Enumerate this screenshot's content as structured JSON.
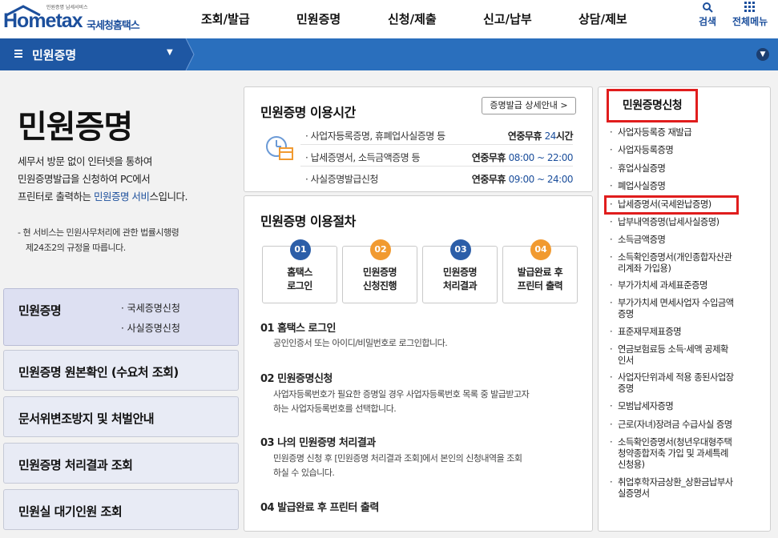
{
  "header": {
    "logo_small": "민원증명 납세서비스",
    "logo_main": "Hometax",
    "logo_kr": "국세청홈택스",
    "nav": [
      "조회/발급",
      "민원증명",
      "신청/제출",
      "신고/납부",
      "상담/제보"
    ],
    "search_label": "검색",
    "allmenu_label": "전체메뉴"
  },
  "bar": {
    "title": "민원증명"
  },
  "left": {
    "page_title": "민원증명",
    "desc_line1": "세무서 방문 없이 인터넷을 통하여",
    "desc_line2": "민원증명발급을 신청하여 PC에서",
    "desc_line3_pre": "프린터로 출력하는 ",
    "desc_line3_link": "민원증명 서비",
    "desc_line3_post": "스입니다.",
    "note_line1": "- 현 서비스는 민원사무처리에 관한 법률시행령",
    "note_line2": "제24조2의 규정을 따릅니다.",
    "boxes": [
      {
        "title": "민원증명",
        "subs": [
          "· 국세증명신청",
          "· 사실증명신청"
        ]
      },
      {
        "title": "민원증명 원본확인 (수요처 조회)"
      },
      {
        "title": "문서위변조방지 및 처벌안내"
      },
      {
        "title": "민원증명 처리결과 조회"
      },
      {
        "title": "민원실 대기인원 조회"
      }
    ]
  },
  "hours": {
    "title": "민원증명 이용시간",
    "detail_button": "증명발급 상세안내 >",
    "rows": [
      {
        "label": "· 사업자등록증명, 휴폐업사실증명 등",
        "prefix": "연중무휴 ",
        "time": "24",
        "suffix": "시간"
      },
      {
        "label": "· 납세증명서, 소득금액증명 등",
        "prefix": "연중무휴 ",
        "time": "08:00 ~ 22:00",
        "suffix": ""
      },
      {
        "label": "· 사실증명발급신청",
        "prefix": "연중무휴 ",
        "time": "09:00 ~ 24:00",
        "suffix": ""
      }
    ]
  },
  "procedure": {
    "title": "민원증명 이용절차",
    "steps": [
      {
        "num": "01",
        "line1": "홈택스",
        "line2": "로그인",
        "color": "#2c5ea8"
      },
      {
        "num": "02",
        "line1": "민원증명",
        "line2": "신청진행",
        "color": "#f19a30"
      },
      {
        "num": "03",
        "line1": "민원증명",
        "line2": "처리결과",
        "color": "#2c5ea8"
      },
      {
        "num": "04",
        "line1": "발급완료 후",
        "line2": "프린터 출력",
        "color": "#f19a30"
      }
    ],
    "items": [
      {
        "head": "01 홈택스 로그인",
        "desc": [
          "공인인증서 또는 아이디/비밀번호로 로그인합니다."
        ]
      },
      {
        "head": "02 민원증명신청",
        "desc": [
          "사업자등록번호가 필요한 증명일 경우 사업자등록번호 목록 중 발급받고자",
          "하는 사업자등록번호를 선택합니다."
        ]
      },
      {
        "head": "03 나의 민원증명 처리결과",
        "desc": [
          "민원증명 신청 후 [민원증명 처리결과 조회]에서 본인의 신청내역을 조회",
          "하실 수 있습니다."
        ]
      },
      {
        "head": "04 발급완료 후 프린터 출력",
        "desc": []
      }
    ]
  },
  "right": {
    "title": "민원증명신청",
    "items": [
      [
        "사업자등록증 재발급"
      ],
      [
        "사업자등록증명"
      ],
      [
        "휴업사실증명"
      ],
      [
        "폐업사실증명"
      ],
      [
        "납세증명서(국세완납증명)"
      ],
      [
        "납부내역증명(납세사실증명)"
      ],
      [
        "소득금액증명"
      ],
      [
        "소득확인증명서(개인종합자산관",
        "리계좌 가입용)"
      ],
      [
        "부가가치세 과세표준증명"
      ],
      [
        "부가가치세 면세사업자 수입금액",
        "증명"
      ],
      [
        "표준재무제표증명"
      ],
      [
        "연금보험료등 소득·세액 공제확",
        "인서"
      ],
      [
        "사업자단위과세 적용 종된사업장",
        "증명"
      ],
      [
        "모범납세자증명"
      ],
      [
        "근로(자녀)장려금 수급사실 증명"
      ],
      [
        "소득확인증명서(청년우대형주택",
        "청약종합저축 가입 및 과세특례",
        "신청용)"
      ],
      [
        "취업후학자금상환_상환금납부사",
        "실증명서"
      ]
    ]
  },
  "colors": {
    "accent": "#2a6fbd",
    "highlight": "#e01d1d",
    "orange": "#f19a30"
  }
}
